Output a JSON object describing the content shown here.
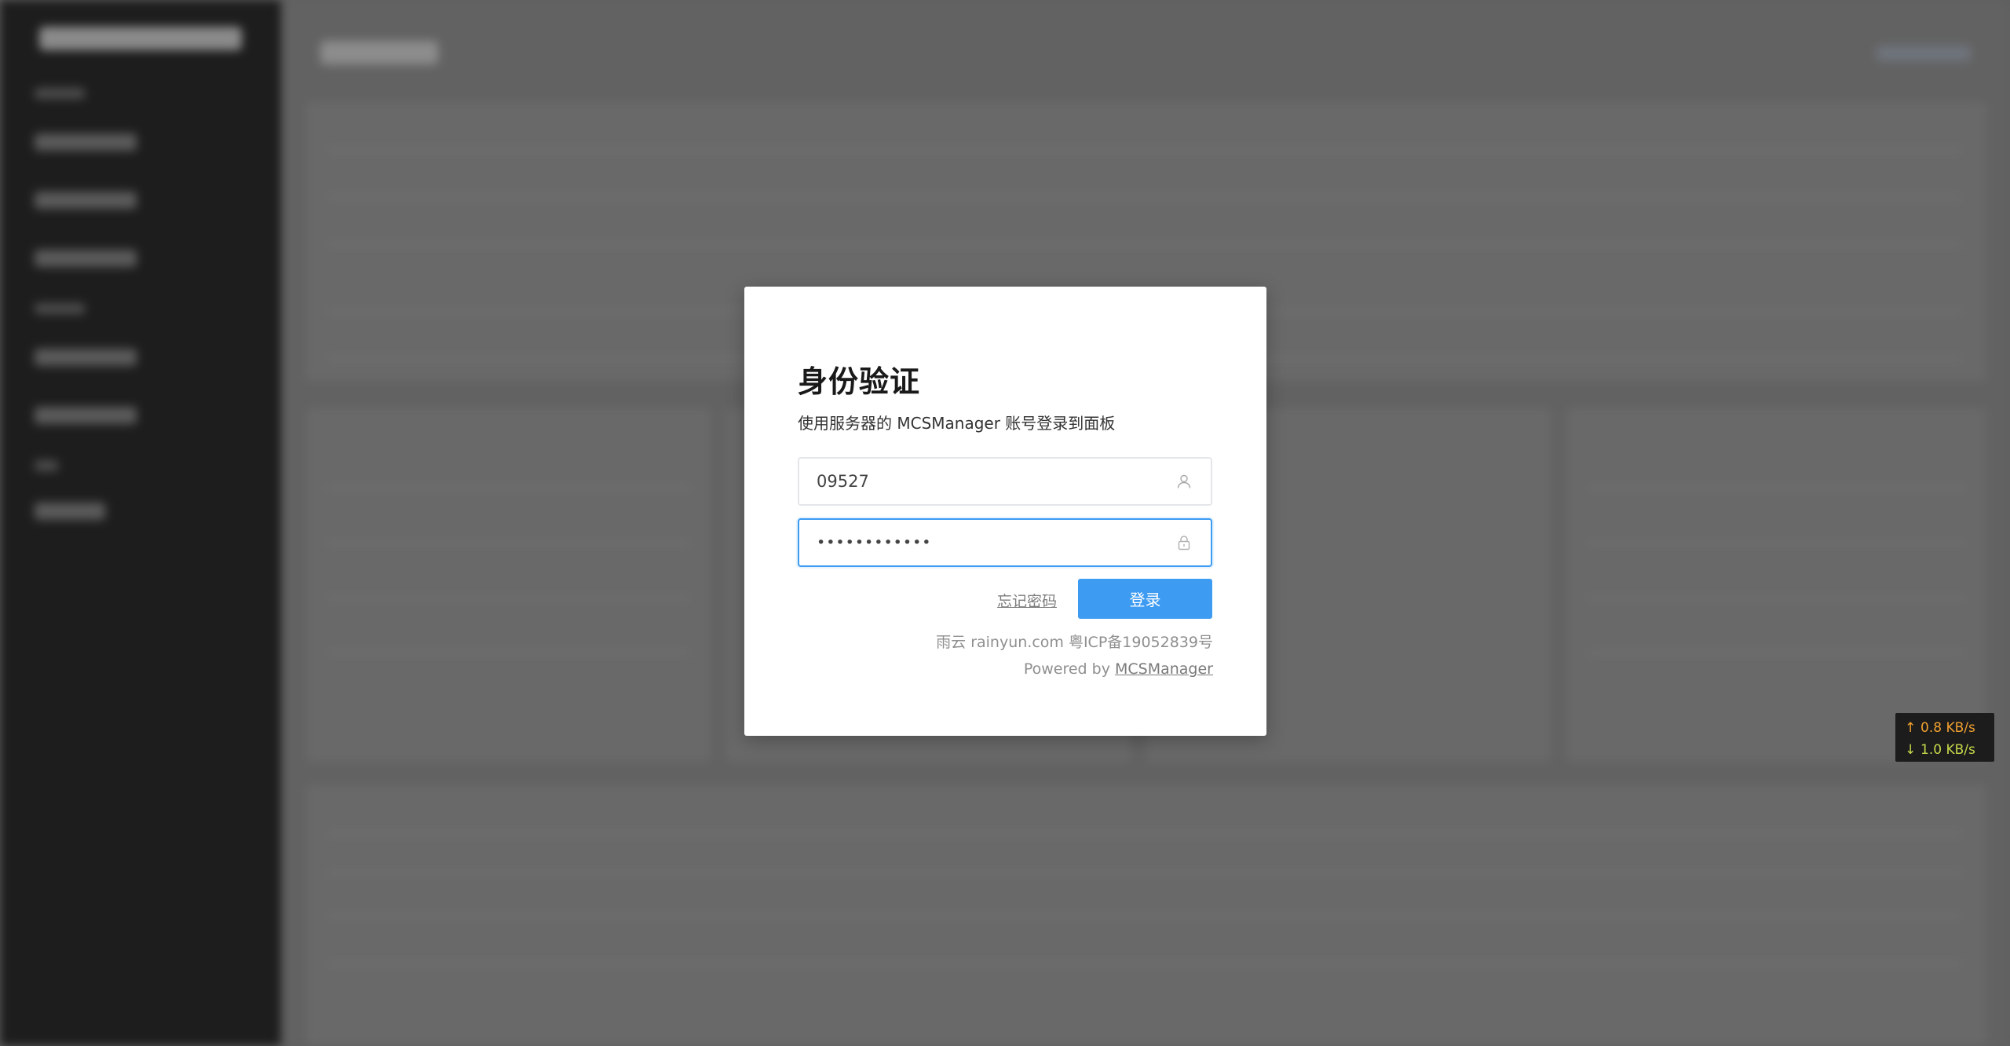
{
  "modal": {
    "title": "身份验证",
    "subtitle": "使用服务器的 MCSManager 账号登录到面板",
    "username_value": "09527",
    "password_value": "••••••••••••",
    "forgot_label": "忘记密码",
    "login_label": "登录",
    "icp_text": "雨云 rainyun.com 粤ICP备19052839号",
    "powered_prefix": "Powered by ",
    "powered_link": "MCSManager"
  },
  "net_speed": {
    "up_arrow": "↑",
    "up": "0.8 KB/s",
    "down_arrow": "↓",
    "down": "1.0 KB/s"
  },
  "colors": {
    "accent": "#3d9bf2",
    "upload": "#f0a030",
    "download": "#c8d84a"
  },
  "icons": {
    "username": "user-icon",
    "password": "lock-icon"
  }
}
